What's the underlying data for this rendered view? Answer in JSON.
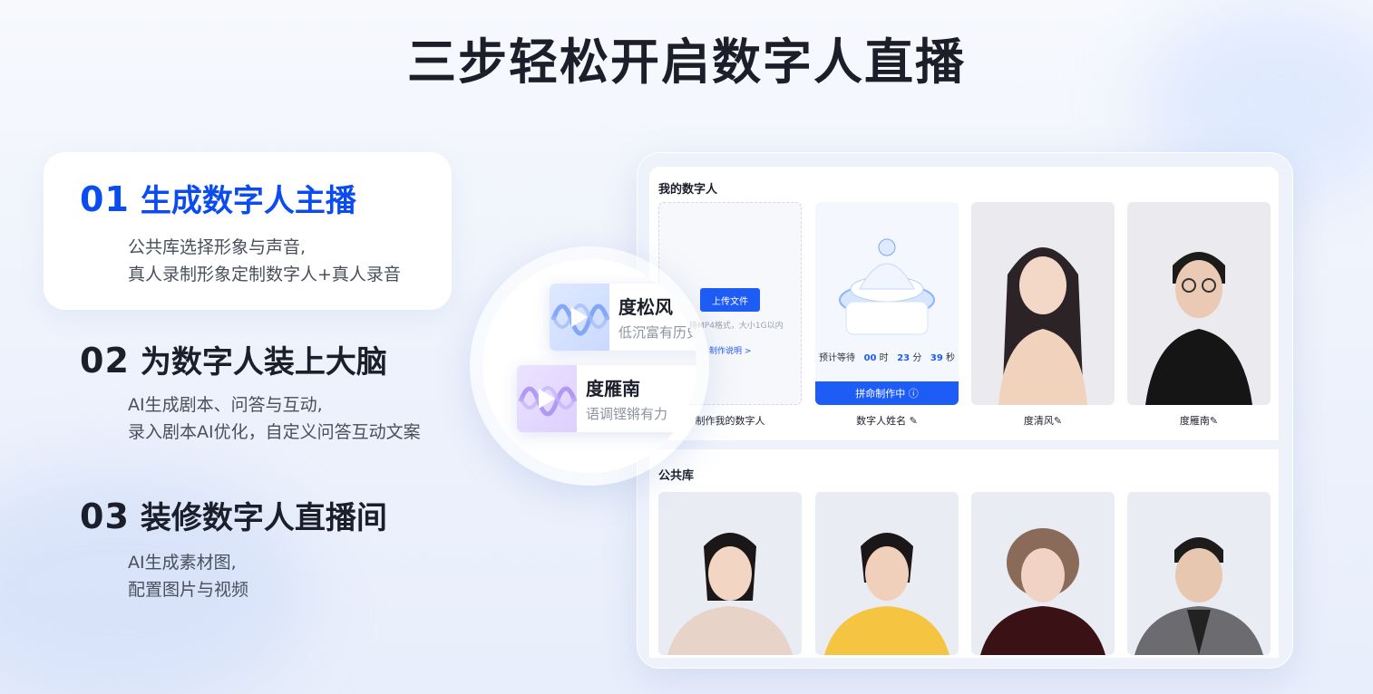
{
  "title": "三步轻松开启数字人直播",
  "steps": [
    {
      "num": "01",
      "title": "生成数字人主播",
      "desc1": "公共库选择形象与声音,",
      "desc2": "真人录制形象定制数字人+真人录音"
    },
    {
      "num": "02",
      "title": "为数字人装上大脑",
      "desc1": "AI生成剧本、问答与互动,",
      "desc2": "录入剧本AI优化，自定义问答互动文案"
    },
    {
      "num": "03",
      "title": "装修数字人直播间",
      "desc1": "AI生成素材图,",
      "desc2": "配置图片与视频"
    }
  ],
  "voices": [
    {
      "name": "度松风",
      "desc": "低沉富有历史"
    },
    {
      "name": "度雁南",
      "desc": "语调铿锵有力"
    }
  ],
  "my_digital": {
    "title": "我的数字人",
    "upload_label": "上传文件",
    "upload_hint": "持MP4格式，大小1G以内",
    "guide_link": "制作说明 >",
    "create_label": "制作我的数字人",
    "wait_prefix": "预计等待",
    "h": "00",
    "h_unit": "时",
    "m": "23",
    "m_unit": "分",
    "s": "39",
    "s_unit": "秒",
    "progress_label": "拼命制作中 ⓘ",
    "pending_name": "数字人姓名",
    "avatar1_name": "度清风",
    "avatar2_name": "度雁南"
  },
  "public_lib": {
    "title": "公共库"
  },
  "colors": {
    "accent": "#0b4cf0",
    "button": "#1d5cf5"
  }
}
